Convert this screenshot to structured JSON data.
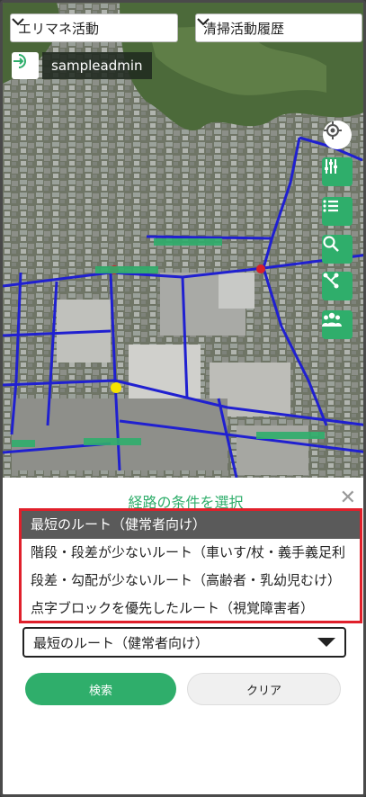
{
  "header": {
    "left_select": "エリマネ活動",
    "right_select": "清掃活動履歴"
  },
  "user": {
    "name": "sampleadmin",
    "icon": "login-icon"
  },
  "map_controls": [
    {
      "name": "locate-icon"
    },
    {
      "name": "filter-sliders-icon"
    },
    {
      "name": "list-icon"
    },
    {
      "name": "search-icon"
    },
    {
      "name": "route-icon"
    },
    {
      "name": "people-icon"
    }
  ],
  "route_panel": {
    "title": "経路の条件を選択",
    "close_icon": "close-icon",
    "options": [
      "最短のルート（健常者向け）",
      "階段・段差が少ないルート（車いす/杖・義手義足利",
      "段差・勾配が少ないルート（高齢者・乳幼児むけ）",
      "点字ブロックを優先したルート（視覚障害者）"
    ],
    "selected": "最短のルート（健常者向け）",
    "search_label": "検索",
    "clear_label": "クリア"
  },
  "colors": {
    "accent": "#2fae6b",
    "highlight_border": "#e0202b",
    "route_line": "#2020d0"
  }
}
